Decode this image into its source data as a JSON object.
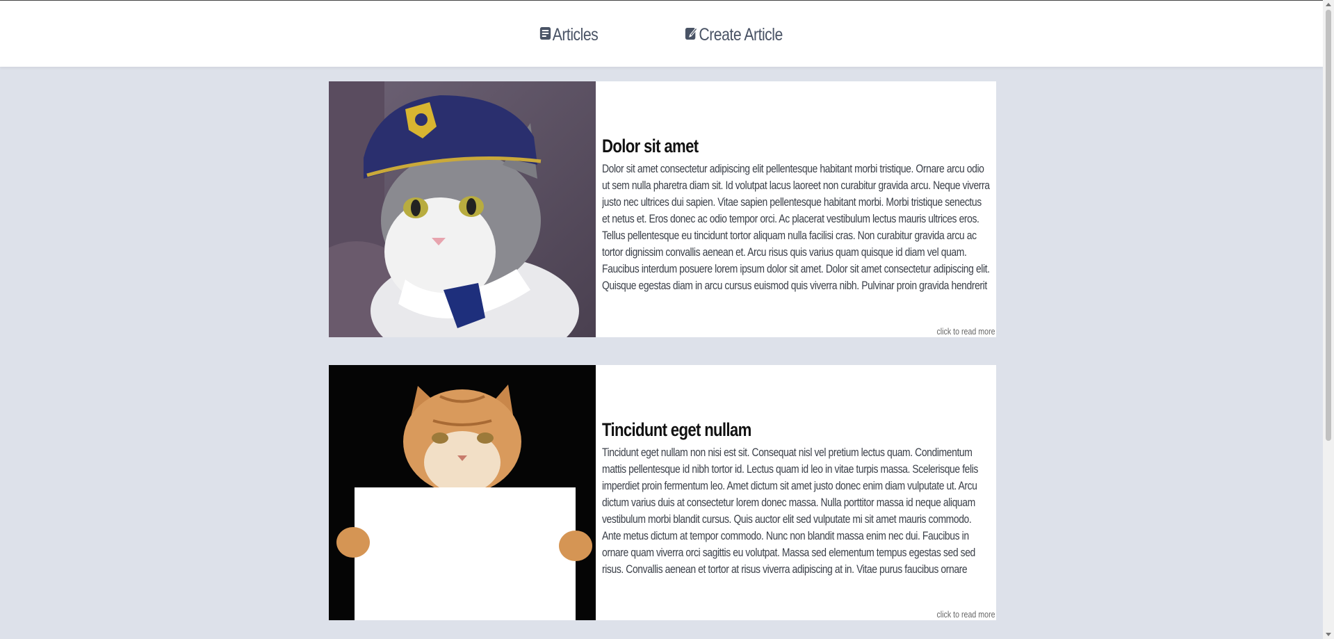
{
  "nav": {
    "articles": {
      "label": "Articles",
      "icon": "article-icon"
    },
    "create": {
      "label": "Create Article",
      "icon": "edit-icon"
    }
  },
  "articles": [
    {
      "title": "Dolor sit amet",
      "body": "Dolor sit amet consectetur adipiscing elit pellentesque habitant morbi tristique. Ornare arcu odio ut sem nulla pharetra diam sit. Id volutpat lacus laoreet non curabitur gravida arcu. Neque viverra justo nec ultrices dui sapien. Vitae sapien pellentesque habitant morbi. Morbi tristique senectus et netus et. Eros donec ac odio tempor orci. Ac placerat vestibulum lectus mauris ultrices eros. Tellus pellentesque eu tincidunt tortor aliquam nulla facilisi cras. Non curabitur gravida arcu ac tortor dignissim convallis aenean et. Arcu risus quis varius quam quisque id diam vel quam. Faucibus interdum posuere lorem ipsum dolor sit amet. Dolor sit amet consectetur adipiscing elit. Quisque egestas diam in arcu cursus euismod quis viverra nibh. Pulvinar proin gravida hendrerit lectus a. Laoreet suspendisse interdum consectetur libero id. Id",
      "read_more": "click to read more",
      "image": "cat-in-police-cap"
    },
    {
      "title": "Tincidunt eget nullam",
      "body": "Tincidunt eget nullam non nisi est sit. Consequat nisl vel pretium lectus quam. Condimentum mattis pellentesque id nibh tortor id. Lectus quam id leo in vitae turpis massa. Scelerisque felis imperdiet proin fermentum leo. Amet dictum sit amet justo donec enim diam vulputate ut. Arcu dictum varius duis at consectetur lorem donec massa. Nulla porttitor massa id neque aliquam vestibulum morbi blandit cursus. Quis auctor elit sed vulputate mi sit amet mauris commodo. Ante metus dictum at tempor commodo. Nunc non blandit massa enim nec dui. Faucibus in ornare quam viverra orci sagittis eu volutpat. Massa sed elementum tempus egestas sed sed risus. Convallis aenean et tortor at risus viverra adipiscing at in. Vitae purus faucibus ornare suspendisse. Massa tincidunt dui ut ornare lectus sit amet est. Sit amet purus gravida quis",
      "read_more": "click to read more",
      "image": "cat-holding-blank-sign"
    }
  ],
  "colors": {
    "page_bg": "#dde1ea",
    "header_bg": "#ffffff",
    "nav_text": "#495365",
    "card_bg": "#ffffff"
  }
}
